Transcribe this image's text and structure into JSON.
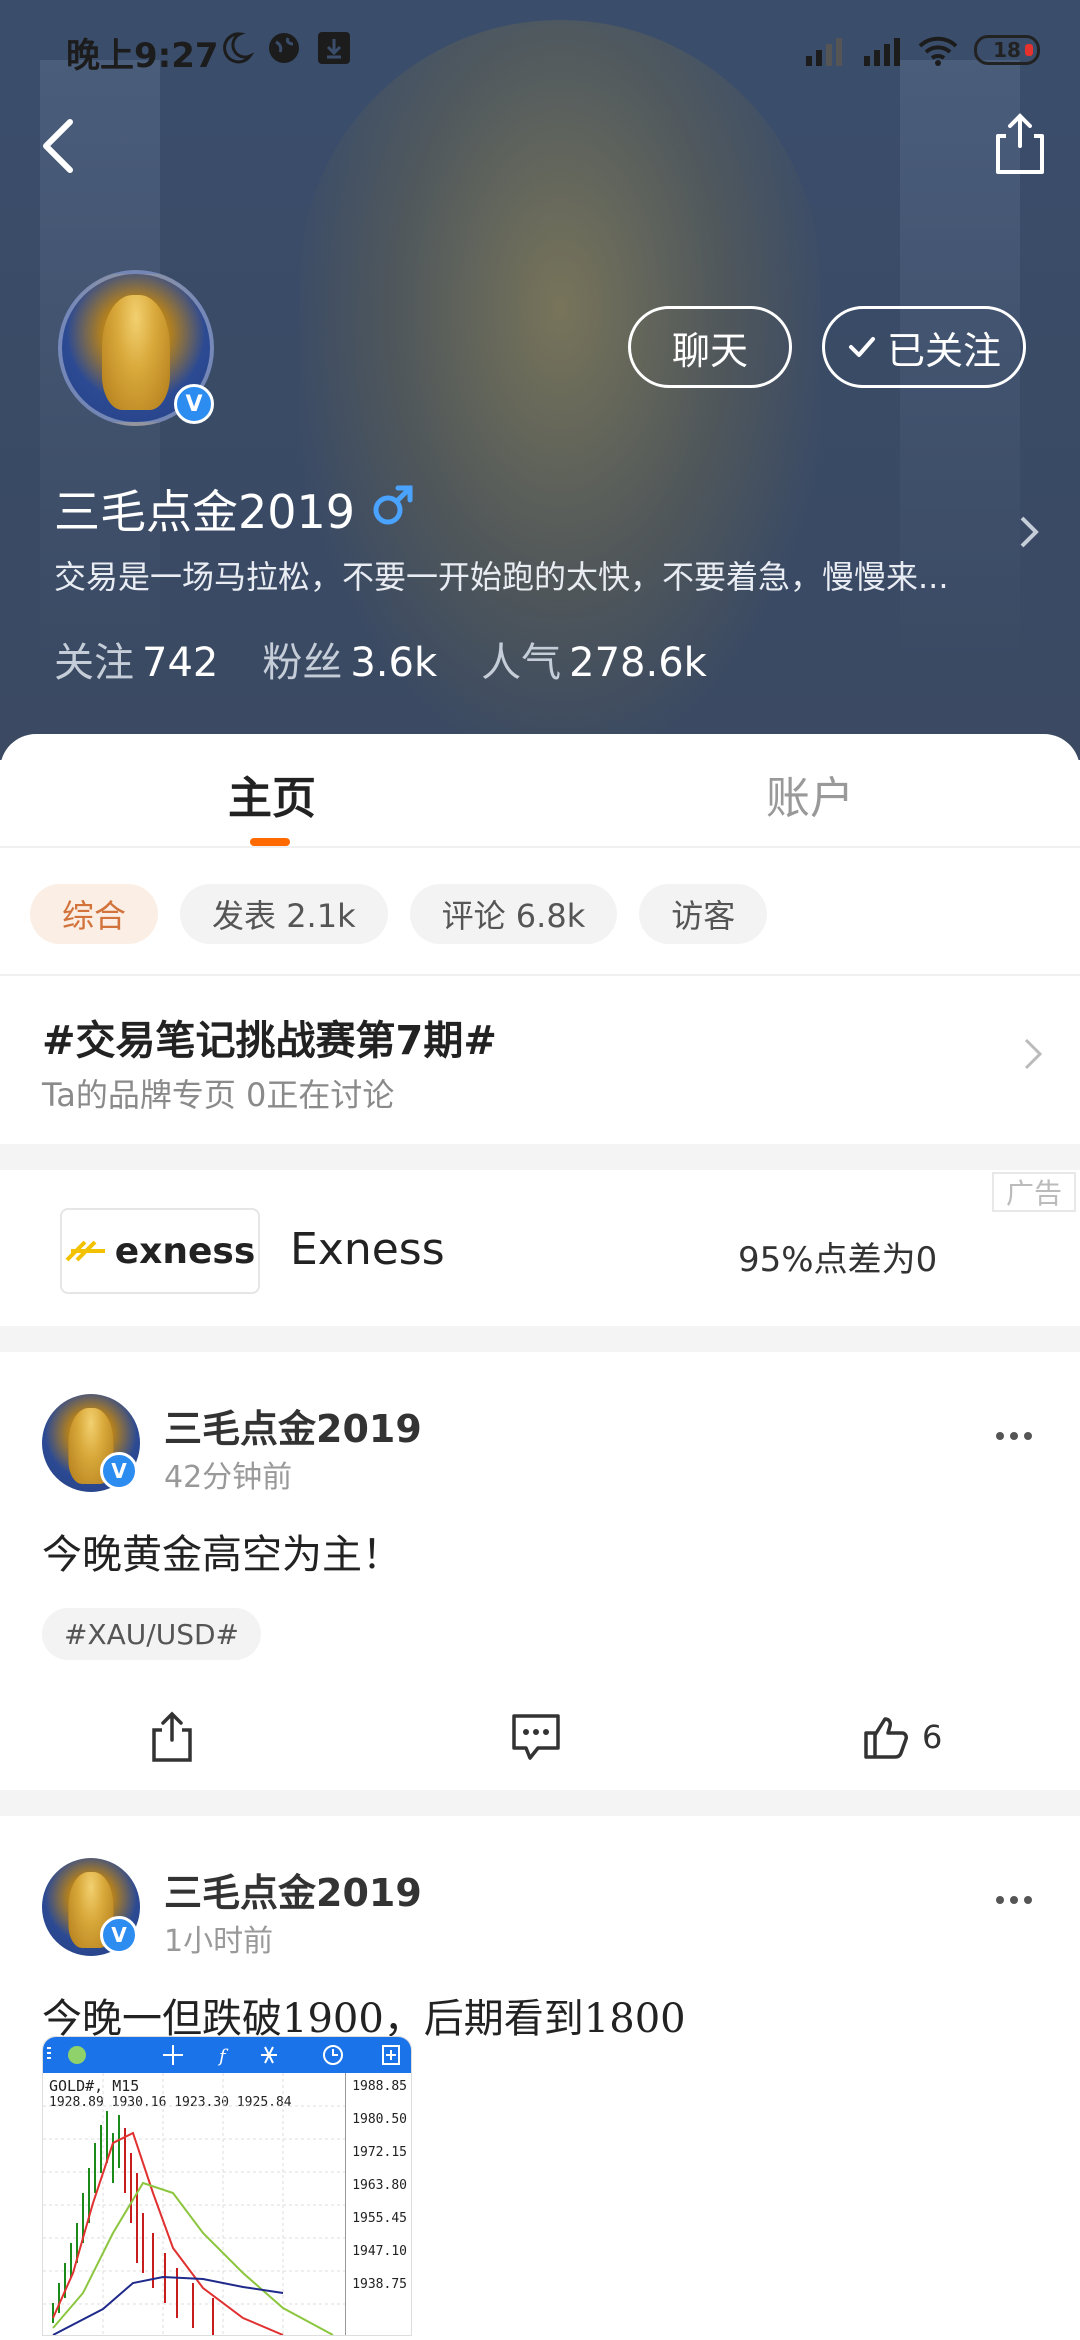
{
  "status_bar": {
    "time": "晚上9:27",
    "battery": "18"
  },
  "profile": {
    "name": "三毛点金2019",
    "bio": "交易是一场马拉松，不要一开始跑的太快，不要着急，慢慢来...",
    "chat_label": "聊天",
    "follow_label": "已关注",
    "stats": [
      {
        "label": "关注",
        "value": "742"
      },
      {
        "label": "粉丝",
        "value": "3.6k"
      },
      {
        "label": "人气",
        "value": "278.6k"
      }
    ]
  },
  "tabs": [
    {
      "label": "主页"
    },
    {
      "label": "账户"
    }
  ],
  "filters": [
    {
      "label": "综合"
    },
    {
      "label": "发表 2.1k"
    },
    {
      "label": "评论 6.8k"
    },
    {
      "label": "访客"
    }
  ],
  "topic": {
    "title": "#交易笔记挑战赛第7期#",
    "subtitle": "Ta的品牌专页  0正在讨论"
  },
  "ad": {
    "logo_text": "exness",
    "name": "Exness",
    "description": "95%点差为0",
    "tag": "广告"
  },
  "posts": [
    {
      "author": "三毛点金2019",
      "time": "42分钟前",
      "text": "今晚黄金高空为主！",
      "hashtag": "#XAU/USD#",
      "likes": "6"
    },
    {
      "author": "三毛点金2019",
      "time": "1小时前",
      "text": "今晚一但跌破1900，后期看到1800",
      "chart_title": "GOLD#, M15",
      "chart_quotes": "1928.89 1930.16 1923.30 1925.84",
      "chart_ticks": [
        "1988.85",
        "1980.50",
        "1972.15",
        "1963.80",
        "1955.45",
        "1947.10",
        "1938.75"
      ]
    }
  ],
  "colors": {
    "accent": "#ff6a00",
    "verified": "#2d8cf0",
    "chip_active_bg": "#fbeee4",
    "chip_active_text": "#d2733b"
  }
}
